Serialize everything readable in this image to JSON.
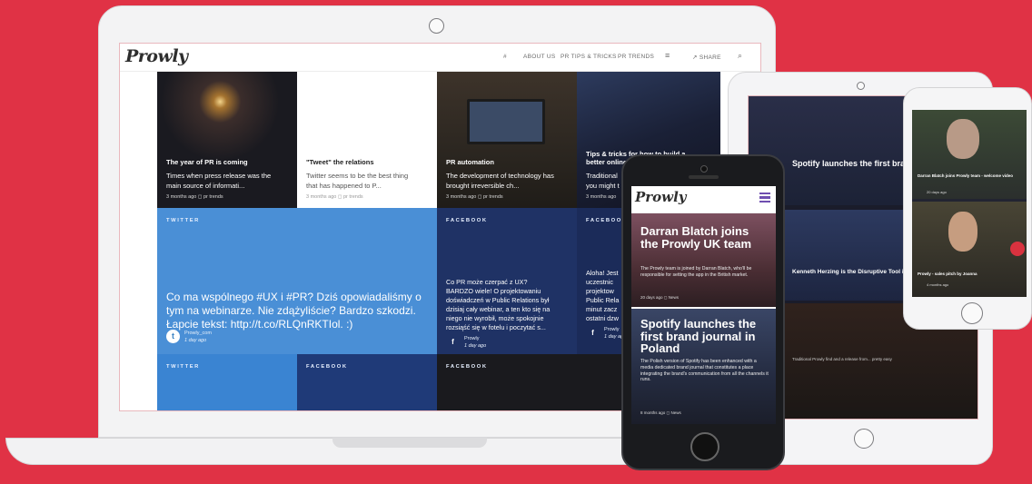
{
  "brand": {
    "logo": "Prowly"
  },
  "nav": {
    "hash": "#",
    "about": "ABOUT US",
    "tips": "PR TIPS & TRICKS",
    "trends": "PR TRENDS",
    "menu": "≡",
    "share": "↗ SHARE",
    "search": "⌕"
  },
  "articles": [
    {
      "title": "The year of PR is coming",
      "excerpt1": "Times when press release was the",
      "excerpt2": "main source of informati...",
      "meta": "3 months ago ◻ pr trends"
    },
    {
      "title": "\"Tweet\" the relations",
      "excerpt1": "Twitter seems to be the best thing",
      "excerpt2": "that has happened to P...",
      "meta": "3 months ago ◻ pr trends"
    },
    {
      "title": "PR automation",
      "excerpt1": "The development of technology has",
      "excerpt2": "brought irreversible ch...",
      "meta": "3 months ago ◻ pr trends"
    },
    {
      "title": "Tips & tricks for how to build a",
      "title2": "better online",
      "excerpt1": "Traditional",
      "excerpt2": "you might t",
      "meta": "3 months ago"
    }
  ],
  "social": {
    "twitter_label": "TWITTER",
    "facebook_label": "FACEBOOK",
    "tweet_line1": "Co ma wspólnego #UX i #PR? Dziś opowiadaliśmy o",
    "tweet_line2": "tym na webinarze. Nie zdążyliście? Bardzo szkodzi.",
    "tweet_line3": "Łapcie tekst: http://t.co/RLQnRKTIol. :)",
    "tweet_author": "Prowly_com",
    "tweet_time": "1 day ago",
    "fb1_lines": [
      "Co PR może czerpać z UX?",
      "BARDZO wiele! O projektowaniu",
      "doświadczeń w Public Relations był",
      "dzisiaj cały webinar, a ten kto się na",
      "niego nie wyrobił, może spokojnie",
      "rozsiąść się w fotelu i poczytać s..."
    ],
    "fb1_author": "Prowly",
    "fb1_time": "1 day ago",
    "fb2_lines": [
      "Aloha! Jest",
      "uczestnic",
      "projektow",
      "Public Rela",
      "minut zacz",
      "ostatni dzw"
    ],
    "fb2_author": "Prowly",
    "fb2_time": "1 day ago"
  },
  "phone": {
    "logo": "Prowly",
    "story1_title": "Darran Blatch joins the Prowly UK team",
    "story1_body": "The Prowly team is joined by Darran Blatch, who'll be responsible for setting the app in the British market.",
    "story1_meta": "20 days ago ◻ News",
    "story2_title": "Spotify launches the first brand journal in Poland",
    "story2_body": "The Polish version of Spotify has been enhanced with a media dedicated brand journal that constitutes a place integrating the brand's communication from all the channels it runs.",
    "story2_meta": "8 months ago ◻ News"
  },
  "tablet": {
    "headline": "Spotify launches the first brand journal",
    "headline2": "Kenneth Herzing is the Disruptive Tool in Marketing",
    "caption": "Traditional Prowly find and a release from... pretty easy"
  },
  "phone_small": {
    "card1": "Darran Blatch joins Prowly team - welcome video",
    "card1_meta": "20 days ago",
    "card2": "Prowly - sales pitch by Joanna",
    "card2_meta": "4 months ago"
  },
  "colors": {
    "background": "#e03245",
    "twitter_tile": "#4a8fd6",
    "facebook_tile": "#27427c"
  }
}
